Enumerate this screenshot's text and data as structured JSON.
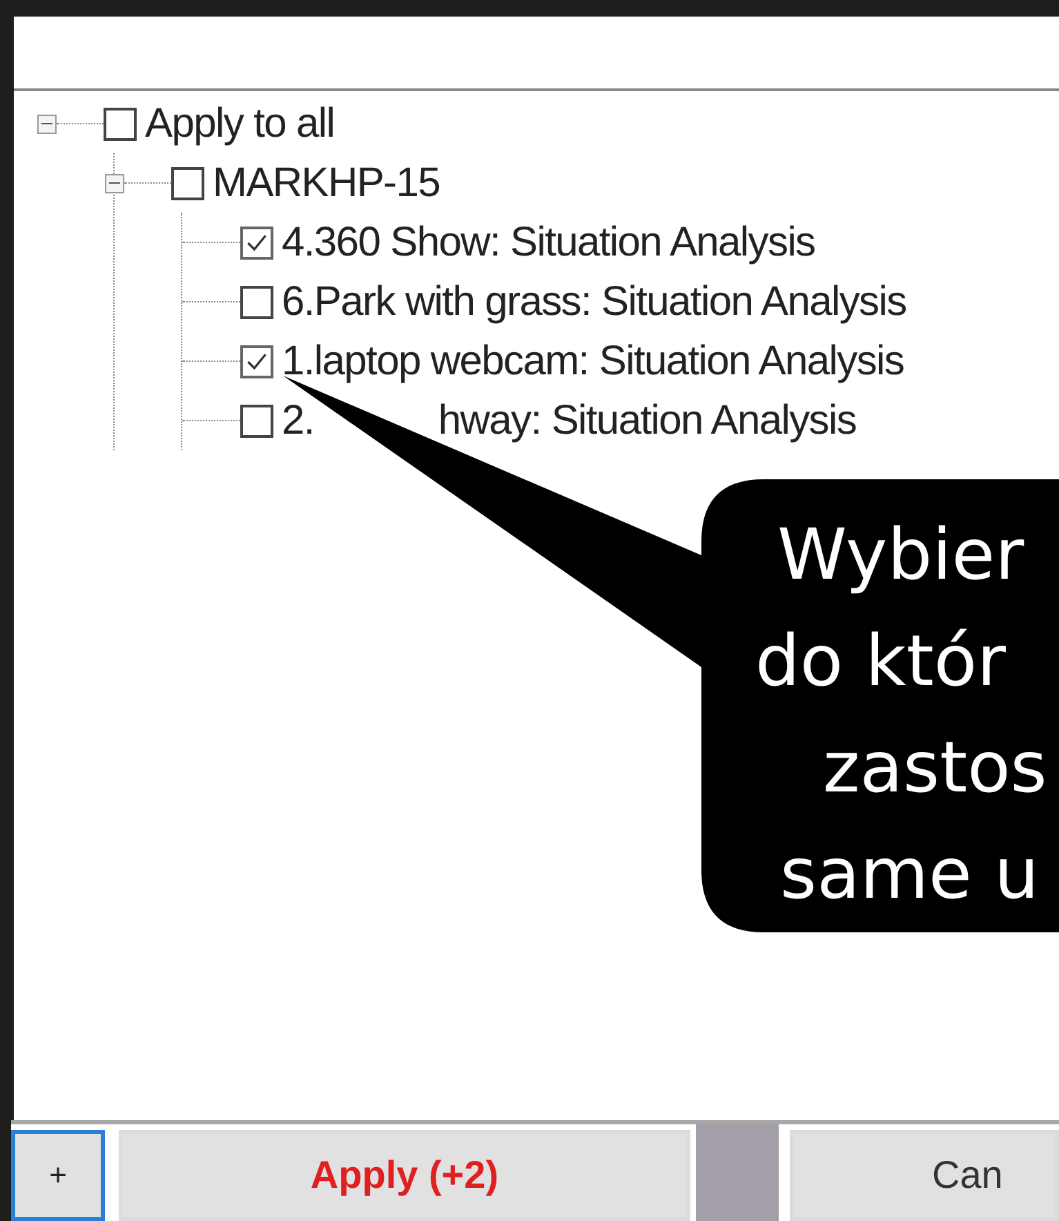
{
  "tree": [
    {
      "label": "Apply to all",
      "checked": false,
      "expanded": true,
      "children": [
        {
          "label": "MARKHP-15",
          "checked": false,
          "expanded": true,
          "children": [
            {
              "label": "4.360 Show: Situation Analysis",
              "checked": true
            },
            {
              "label": "6.Park with grass: Situation Analysis",
              "checked": false
            },
            {
              "label": "1.laptop webcam: Situation Analysis",
              "checked": true
            },
            {
              "label_parts": [
                "2.",
                "hway: Situation Analysis"
              ],
              "checked": false
            }
          ]
        }
      ]
    }
  ],
  "callout": {
    "lines": [
      "Wybier",
      "do któr",
      "zastos",
      "same u"
    ]
  },
  "buttons": [
    {
      "label": "+",
      "kind": "add",
      "focused": true
    },
    {
      "label": "Apply (+2)",
      "kind": "apply",
      "focused": false
    },
    {
      "label": "Can",
      "kind": "cancel",
      "focused": false
    }
  ]
}
